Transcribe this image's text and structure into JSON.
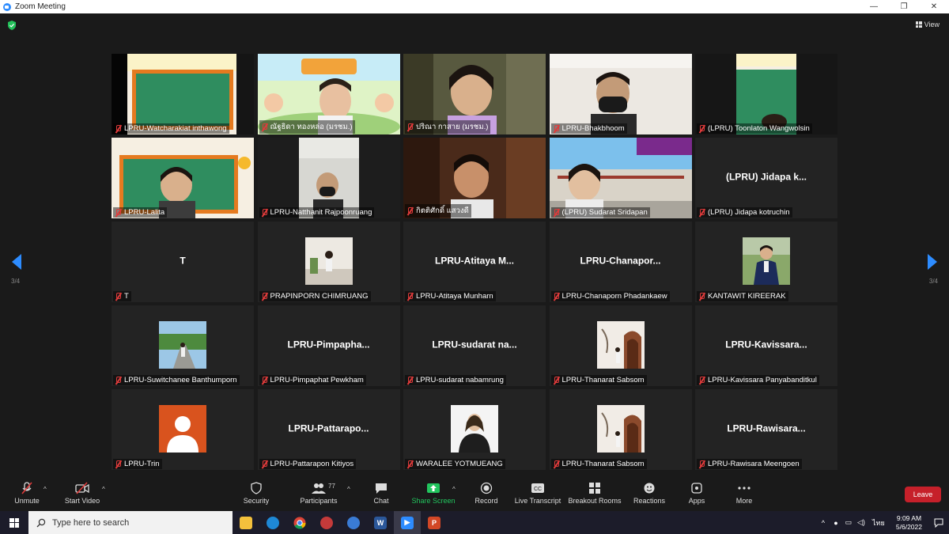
{
  "window": {
    "title": "Zoom Meeting"
  },
  "header": {
    "view_label": "View"
  },
  "pagination": {
    "left_label": "3/4",
    "right_label": "3/4"
  },
  "tiles": [
    {
      "name": "LPRU-Watcharakiat inthawong",
      "kind": "video"
    },
    {
      "name": "ณัฐธิดา ทองหล่อ (มรชม.)",
      "kind": "video"
    },
    {
      "name": "ปริณา กาสาย (มรชม.)",
      "kind": "video"
    },
    {
      "name": "LPRU-Bhakbhoom",
      "kind": "video"
    },
    {
      "name": "(LPRU) Toonlaton Wangwolsin",
      "kind": "video"
    },
    {
      "name": "LPRU-Lalita",
      "kind": "video"
    },
    {
      "name": "LPRU-Natthanit Rajpoonruang",
      "kind": "video"
    },
    {
      "name": "กิตติศักดิ์ แสวงดี",
      "kind": "video"
    },
    {
      "name": "(LPRU) Sudarat Sridapan",
      "kind": "video"
    },
    {
      "name": "(LPRU) Jidapa kotruchin",
      "kind": "text",
      "display": "(LPRU) Jidapa k..."
    },
    {
      "name": "T",
      "kind": "text",
      "display": "T"
    },
    {
      "name": "PRAPINPORN CHIMRUANG",
      "kind": "thumb"
    },
    {
      "name": "LPRU-Atitaya Munharn",
      "kind": "text",
      "display": "LPRU-Atitaya M..."
    },
    {
      "name": "LPRU-Chanaporn Phadankaew",
      "kind": "text",
      "display": "LPRU-Chanapor..."
    },
    {
      "name": "KANTAWIT KIREERAK",
      "kind": "thumb"
    },
    {
      "name": "LPRU-Suwitchanee Banthumporn",
      "kind": "thumb"
    },
    {
      "name": "LPRU-Pimpaphat Pewkham",
      "kind": "text",
      "display": "LPRU-Pimpapha..."
    },
    {
      "name": "LPRU-sudarat nabamrung",
      "kind": "text",
      "display": "LPRU-sudarat na..."
    },
    {
      "name": "LPRU-Thanarat Sabsom",
      "kind": "thumb"
    },
    {
      "name": "LPRU-Kavissara Panyabanditkul",
      "kind": "text",
      "display": "LPRU-Kavissara..."
    },
    {
      "name": "LPRU-Trin",
      "kind": "thumb"
    },
    {
      "name": "LPRU-Pattarapon Kitiyos",
      "kind": "text",
      "display": "LPRU-Pattarapo..."
    },
    {
      "name": "WARALEE YOTMUEANG",
      "kind": "thumb"
    },
    {
      "name": "LPRU-Thanarat Sabsom",
      "kind": "thumb"
    },
    {
      "name": "LPRU-Rawisara Meengoen",
      "kind": "text",
      "display": "LPRU-Rawisara..."
    }
  ],
  "toolbar": {
    "unmute": "Unmute",
    "start_video": "Start Video",
    "security": "Security",
    "participants": "Participants",
    "participants_count": "77",
    "chat": "Chat",
    "share_screen": "Share Screen",
    "record": "Record",
    "live_transcript": "Live Transcript",
    "breakout_rooms": "Breakout Rooms",
    "reactions": "Reactions",
    "apps": "Apps",
    "more": "More",
    "leave": "Leave"
  },
  "taskbar": {
    "search_placeholder": "Type here to search",
    "language": "ไทย",
    "time": "9:09 AM",
    "date": "5/6/2022"
  },
  "colors": {
    "accent": "#2d8cff",
    "leave": "#c6202a",
    "share": "#22c55e",
    "muted": "#e03b3b"
  }
}
